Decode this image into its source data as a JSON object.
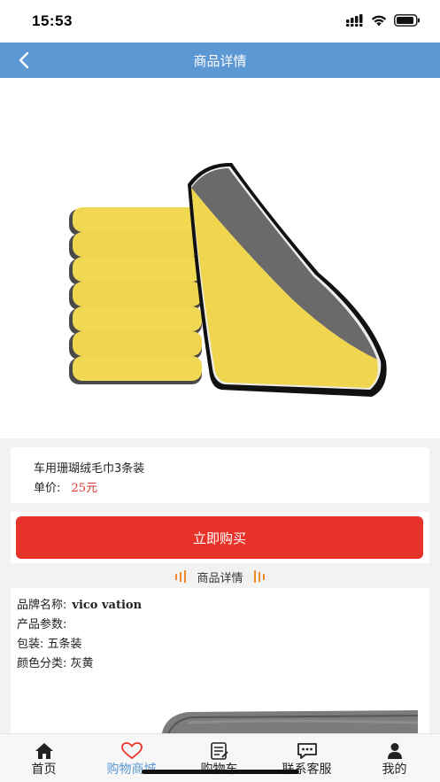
{
  "status_bar": {
    "time": "15:53"
  },
  "header": {
    "title": "商品详情"
  },
  "product": {
    "name": "车用珊瑚绒毛巾3条装",
    "price_label": "单价:",
    "price_value": "25元"
  },
  "buy_button": {
    "label": "立即购买"
  },
  "details": {
    "section_title": "商品详情",
    "brand_label": "品牌名称:",
    "brand_value": "vico vation",
    "params_label": "产品参数:",
    "package": "包装: 五条装",
    "color": "颜色分类: 灰黄"
  },
  "tab_bar": {
    "items": [
      {
        "label": "首页",
        "icon": "home-icon",
        "active": false
      },
      {
        "label": "购物商城",
        "icon": "heart-icon",
        "active": true
      },
      {
        "label": "购物车",
        "icon": "cart-note-icon",
        "active": false
      },
      {
        "label": "联系客服",
        "icon": "chat-icon",
        "active": false
      },
      {
        "label": "我的",
        "icon": "person-icon",
        "active": false
      }
    ]
  },
  "colors": {
    "nav": "#5b98d4",
    "accent_red": "#e8332b",
    "price_red": "#e0332b",
    "divider_orange": "#f08c2e",
    "active_tab": "#5b98d4"
  }
}
